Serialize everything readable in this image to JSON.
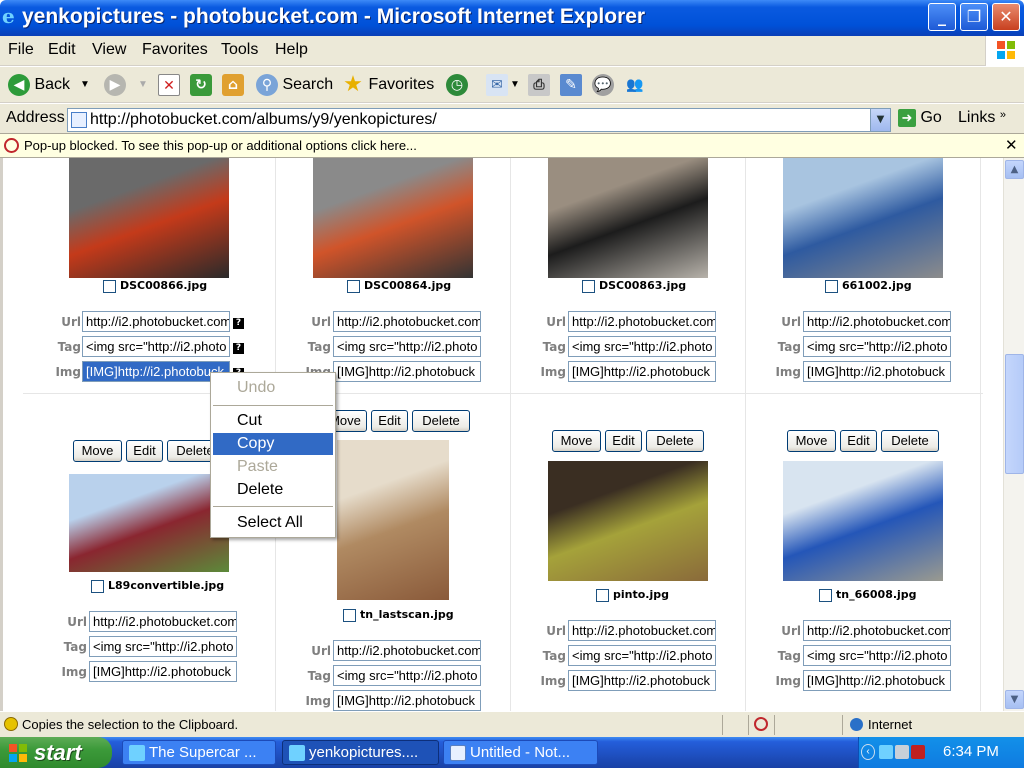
{
  "window": {
    "title": "yenkopictures - photobucket.com - Microsoft Internet Explorer",
    "controls": {
      "minimize": "_",
      "maximize": "❐",
      "close": "✕"
    }
  },
  "menu": [
    "File",
    "Edit",
    "View",
    "Favorites",
    "Tools",
    "Help"
  ],
  "toolbar": {
    "back": "Back",
    "search": "Search",
    "favorites": "Favorites"
  },
  "address": {
    "label": "Address",
    "url": "http://photobucket.com/albums/y9/yenkopictures/",
    "go": "Go",
    "links": "Links"
  },
  "popup_bar": {
    "text": "Pop-up blocked. To see this pop-up or additional options click here...",
    "close": "✕"
  },
  "field_labels": {
    "url": "Url",
    "tag": "Tag",
    "img": "Img",
    "help": "?"
  },
  "action_buttons": {
    "move": "Move",
    "edit": "Edit",
    "delete": "Delete"
  },
  "photos": [
    {
      "file": "DSC00866.jpg",
      "url": "http://i2.photobucket.com",
      "tag": "<img src=\"http://i2.photo",
      "img": "[IMG]http://i2.photobuck",
      "colors": [
        "#6a6a6a",
        "#c43a1a",
        "#2a2a2a"
      ]
    },
    {
      "file": "DSC00864.jpg",
      "url": "http://i2.photobucket.com",
      "tag": "<img src=\"http://i2.photo",
      "img": "[IMG]http://i2.photobuck",
      "colors": [
        "#8a8a8a",
        "#d0542a",
        "#333333"
      ]
    },
    {
      "file": "DSC00863.jpg",
      "url": "http://i2.photobucket.com",
      "tag": "<img src=\"http://i2.photo",
      "img": "[IMG]http://i2.photobuck",
      "colors": [
        "#9a8e80",
        "#1c1c1c",
        "#b7b2aa"
      ]
    },
    {
      "file": "661002.jpg",
      "url": "http://i2.photobucket.com",
      "tag": "<img src=\"http://i2.photo",
      "img": "[IMG]http://i2.photobuck",
      "colors": [
        "#a8c4e0",
        "#2e5aa0",
        "#8c8c8c"
      ]
    },
    {
      "file": "L89convertible.jpg",
      "url": "http://i2.photobucket.com",
      "tag": "<img src=\"http://i2.photo",
      "img": "[IMG]http://i2.photobuck",
      "colors": [
        "#b9d1ec",
        "#8a2630",
        "#5c8a3a"
      ]
    },
    {
      "file": "tn_lastscan.jpg",
      "url": "http://i2.photobucket.com",
      "tag": "<img src=\"http://i2.photo",
      "img": "[IMG]http://i2.photobuck",
      "colors": [
        "#e6dccb",
        "#b08a62",
        "#8a5a3a"
      ]
    },
    {
      "file": "pinto.jpg",
      "url": "http://i2.photobucket.com",
      "tag": "<img src=\"http://i2.photo",
      "img": "[IMG]http://i2.photobuck",
      "colors": [
        "#3a2e22",
        "#a5a23a",
        "#8a6a3a"
      ]
    },
    {
      "file": "tn_66008.jpg",
      "url": "http://i2.photobucket.com",
      "tag": "<img src=\"http://i2.photo",
      "img": "[IMG]http://i2.photobuck",
      "colors": [
        "#d8e4f0",
        "#2456b8",
        "#9a9a90"
      ]
    }
  ],
  "context_menu": [
    "Undo",
    "Cut",
    "Copy",
    "Paste",
    "Delete",
    "Select All"
  ],
  "status": {
    "text": "Copies the selection to the Clipboard.",
    "zone": "Internet"
  },
  "taskbar": {
    "start": "start",
    "tasks": [
      "The Supercar ...",
      "yenkopictures....",
      "Untitled - Not..."
    ],
    "clock": "6:34 PM"
  }
}
